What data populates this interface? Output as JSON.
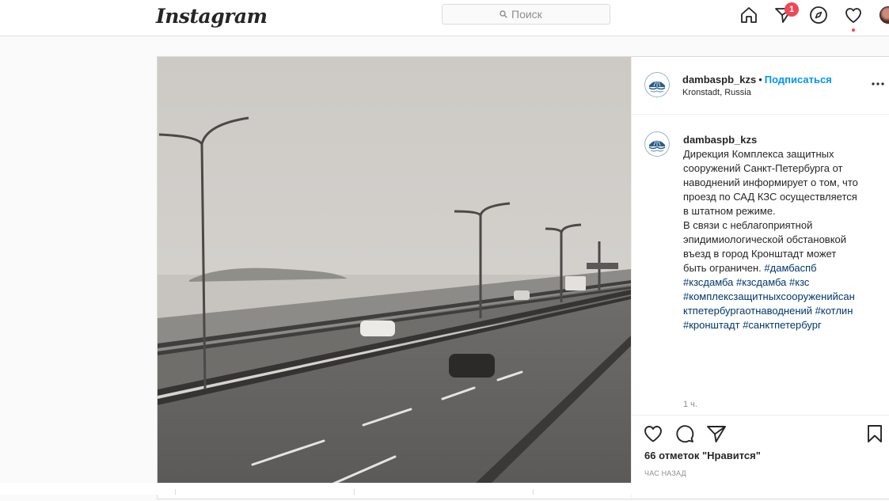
{
  "header": {
    "logo": "Instagram",
    "search_placeholder": "Поиск",
    "icons": [
      "home-icon",
      "direct-icon",
      "explore-icon",
      "activity-icon",
      "profile-avatar"
    ],
    "direct_badge": "1",
    "accent_color": "#ed4956"
  },
  "post": {
    "username": "dambaspb_kzs",
    "separator": "•",
    "follow_label": "Подписаться",
    "location": "Kronstadt, Russia",
    "caption": {
      "username": "dambaspb_kzs",
      "lines": [
        "Дирекция Комплекса защитных",
        "сооружений Санкт-Петербурга от",
        "наводнений информирует о том, что",
        "проезд по САД КЗС осуществляется",
        "в штатном режиме.",
        "В связи с неблагоприятной",
        "эпидимиологической обстановкой",
        "въезд в город Кронштадт может",
        "быть ограничен."
      ],
      "hashtags": [
        "#дамбаспб",
        "#кзсдамба",
        "#кзсдамба",
        "#кзс",
        "#комплексзащитныхсооруженийсан",
        "ктпетербургаотнаводнений",
        "#котлин",
        "#кронштадт",
        "#санктпетербург"
      ],
      "time_ago": "1 ч."
    },
    "likes": "66 отметок \"Нравится\"",
    "posted_ago": "ЧАС НАЗАД",
    "link_color": "#0095f6",
    "hashtag_color": "#00376b"
  }
}
